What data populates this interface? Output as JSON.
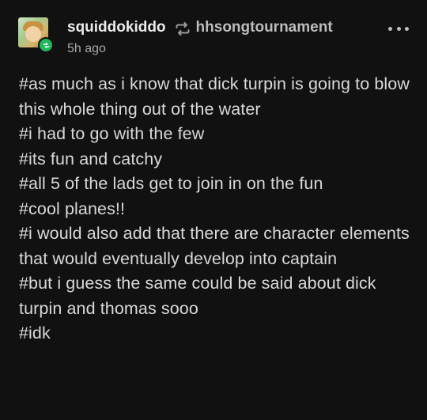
{
  "post": {
    "author": "squiddokiddo",
    "reblogged_from": "hhsongtournament",
    "timestamp": "5h ago",
    "tags": [
      "#as much as i know that dick turpin is going to blow this whole thing out of the water",
      "#i had to go with the few",
      "#its fun and catchy",
      "#all 5 of the lads get to join in on the fun",
      "#cool planes!!",
      "#i would also add that there are character elements that would eventually develop into captain",
      "#but i guess the same could be said about dick turpin and thomas sooo",
      "#idk"
    ]
  },
  "icons": {
    "reblog_badge": "reblog-icon",
    "reblog_separator": "reblog-icon",
    "more_options": "more-options-icon"
  },
  "colors": {
    "background": "#111111",
    "reblog_green": "#1eb85c",
    "text_primary": "#ececec",
    "text_secondary": "#a8a8a8"
  }
}
